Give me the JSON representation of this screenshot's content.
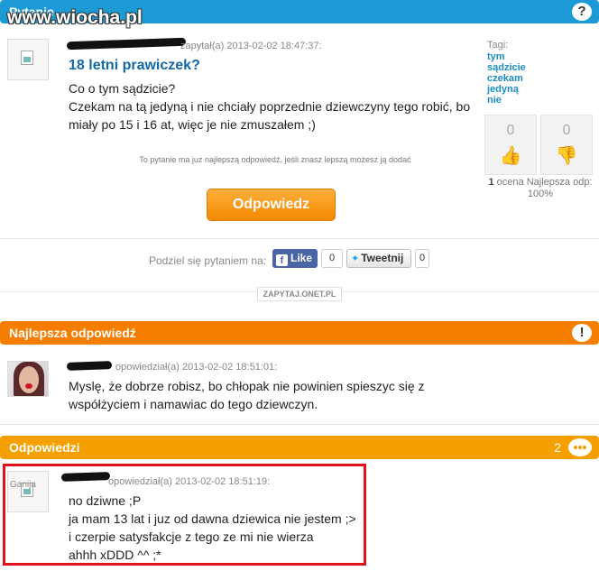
{
  "watermark": "www.wiocha.pl",
  "question": {
    "section_label": "Pytanie",
    "help_icon": "question-mark-icon",
    "author_meta": "zapytał(a) 2013-02-02 18:47:37:",
    "title": "18 letni prawiczek?",
    "body_lines": [
      "Co o tym sądzicie?",
      "Czekam na tą jedyną i nie chciały poprzednie dziewczyny tego robić, bo",
      "miały po 15 i 16 at, więc je nie zmuszałem ;)"
    ],
    "best_answer_note": "To pytanie ma już najlepszą odpowiedź, jeśli znasz lepszą możesz ją dodać",
    "tags_label": "Tagi:",
    "tags": [
      "tym",
      "sądzicie",
      "czekam",
      "jedyną",
      "nie"
    ],
    "votes_up": "0",
    "votes_down": "0",
    "stats_rating_count": "1",
    "stats_rating_label": "ocena",
    "stats_best_label": "Najlepsza odp:",
    "stats_best_value": "100%",
    "answer_button": "Odpowiedz",
    "share_label": "Podziel się pytaniem na:",
    "like_label": "Like",
    "like_count": "0",
    "tweet_label": "Tweetnij",
    "tweet_count": "0",
    "brand": "ZAPYTAJ.ONET.PL"
  },
  "best_answer": {
    "section_label": "Najlepsza odpowiedź",
    "icon": "exclamation-icon",
    "author_meta": "opowiedział(a) 2013-02-02 18:51:01:",
    "body_lines": [
      "Myslę, że dobrze robisz, bo chłopak nie powinien spieszyc się z",
      "współżyciem i namawiac do tego dziewczyn."
    ]
  },
  "answers": {
    "section_label": "Odpowiedzi",
    "count": "2",
    "icon": "speech-bubble-icon",
    "first": {
      "avatar_alt": "Ganija",
      "author_meta": "opowiedział(a) 2013-02-02 18:51:19:",
      "body_lines": [
        "no dziwne ;P",
        "ja mam 13 lat i juz od dawna dziewica nie jestem ;>",
        "i czerpie satysfakcje z tego ze mi nie wierza",
        "ahhh xDDD ^^ ;*"
      ]
    }
  },
  "colors": {
    "question_bar": "#1c9ad6",
    "best_bar": "#f57d00",
    "answers_bar": "#f6a000",
    "highlight": "#e0131b",
    "title_link": "#1267a7"
  }
}
